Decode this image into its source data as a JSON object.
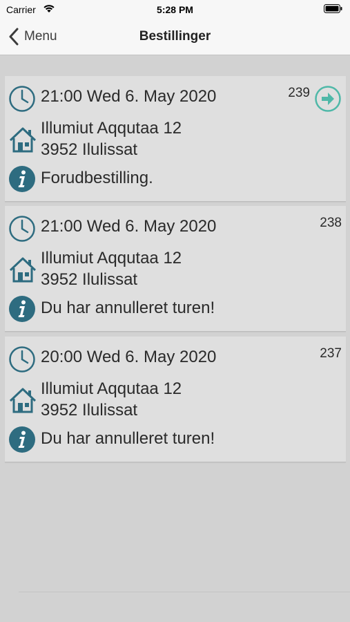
{
  "status_bar": {
    "carrier": "Carrier",
    "time": "5:28 PM"
  },
  "nav": {
    "back_label": "Menu",
    "title": "Bestillinger"
  },
  "colors": {
    "icon": "#2e6c80",
    "accent": "#4fb8a8"
  },
  "orders": [
    {
      "datetime": "21:00 Wed 6. May 2020",
      "number": "239",
      "address_line1": "Illumiut Aqqutaa 12",
      "address_line2": "3952 Ilulissat",
      "info": "Forudbestilling.",
      "has_action": true
    },
    {
      "datetime": "21:00 Wed 6. May 2020",
      "number": "238",
      "address_line1": "Illumiut Aqqutaa 12",
      "address_line2": "3952 Ilulissat",
      "info": "Du har annulleret turen!",
      "has_action": false
    },
    {
      "datetime": "20:00 Wed 6. May 2020",
      "number": "237",
      "address_line1": "Illumiut Aqqutaa 12",
      "address_line2": "3952 Ilulissat",
      "info": "Du har annulleret turen!",
      "has_action": false
    }
  ]
}
